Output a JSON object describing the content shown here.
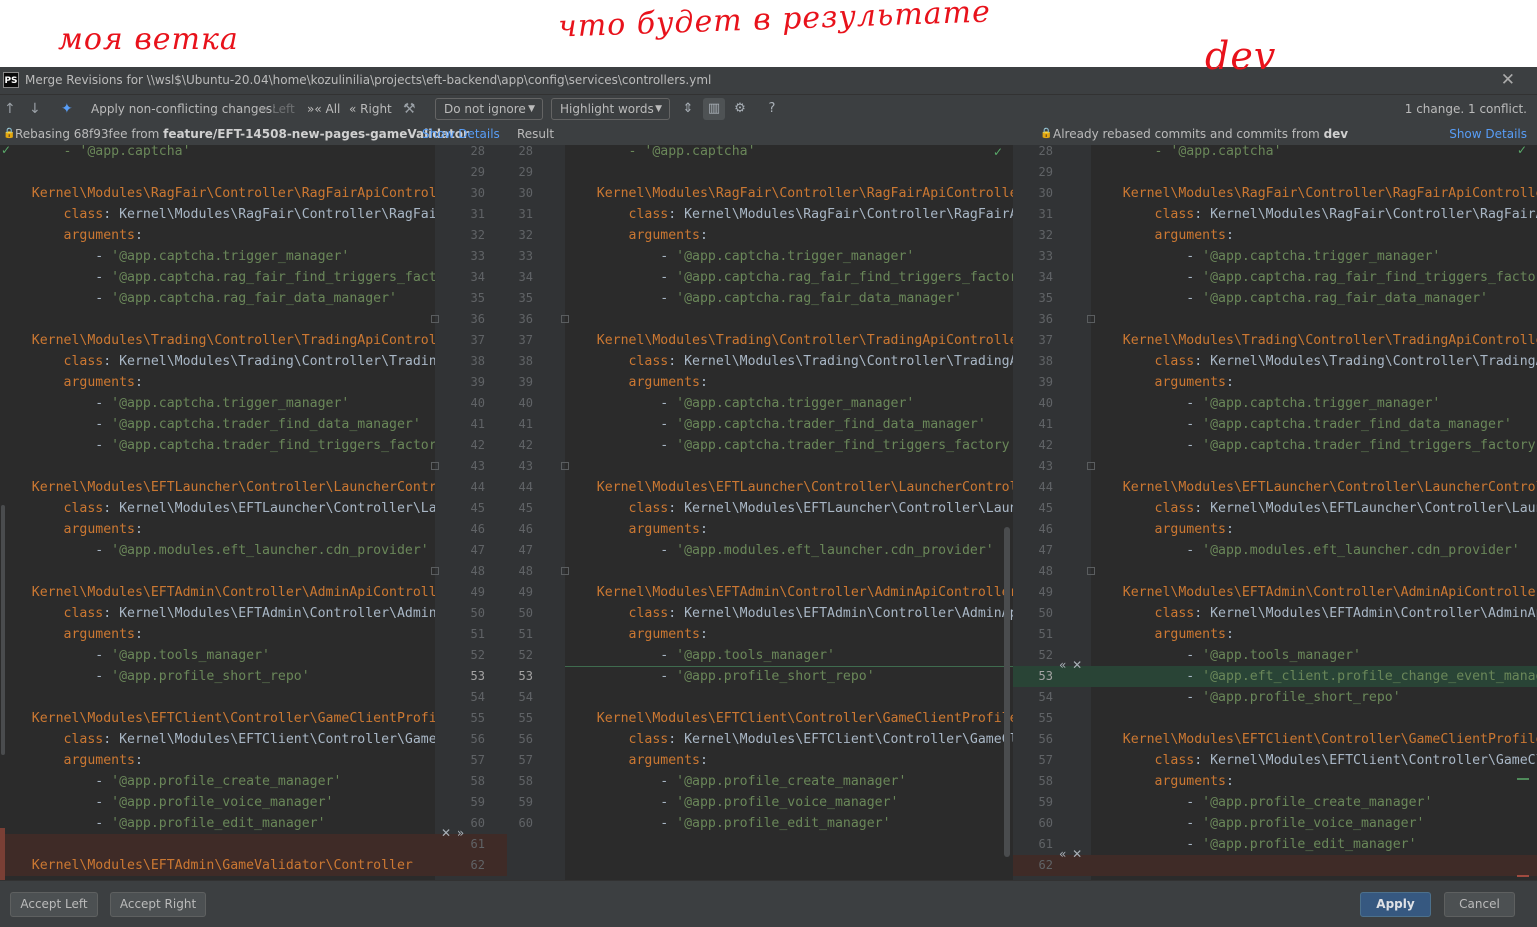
{
  "annotations": {
    "mine": "моя ветка",
    "result": "что будет в результате",
    "dev": "dev"
  },
  "window": {
    "logo": "PS",
    "title": "Merge Revisions for \\\\wsl$\\Ubuntu-20.04\\home\\kozulinilia\\projects\\eft-backend\\app\\config\\services\\controllers.yml"
  },
  "toolbar": {
    "apply_non_conflicting": "Apply non-conflicting changes:",
    "left": "Left",
    "all": "All",
    "right": "Right",
    "whitespace": "Do not ignore",
    "highlight": "Highlight words",
    "status": "1 change. 1 conflict."
  },
  "info": {
    "left_text": "Rebasing 68f93fee from ",
    "left_branch": "feature/EFT-14508-new-pages-gameValidator",
    "show_details": "Show Details",
    "result": "Result",
    "right_text": "Already rebased commits and commits from ",
    "right_branch": "dev"
  },
  "panes": {
    "left": [
      [
        {
          "c": "s",
          "t": "        - '@app.captcha'"
        }
      ],
      [],
      [
        {
          "c": "k",
          "t": "    Kernel\\Modules\\RagFair\\Controller\\RagFairApiController"
        }
      ],
      [
        {
          "c": "k",
          "t": "        class"
        },
        {
          "c": "p",
          "t": ": Kernel\\Modules\\RagFair\\Controller\\RagFairApiController"
        }
      ],
      [
        {
          "c": "k",
          "t": "        arguments"
        },
        {
          "c": "p",
          "t": ":"
        }
      ],
      [
        {
          "c": "p",
          "t": "            - "
        },
        {
          "c": "s",
          "t": "'@app.captcha.trigger_manager'"
        }
      ],
      [
        {
          "c": "p",
          "t": "            - "
        },
        {
          "c": "s",
          "t": "'@app.captcha.rag_fair_find_triggers_factory'"
        }
      ],
      [
        {
          "c": "p",
          "t": "            - "
        },
        {
          "c": "s",
          "t": "'@app.captcha.rag_fair_data_manager'"
        }
      ],
      [],
      [
        {
          "c": "k",
          "t": "    Kernel\\Modules\\Trading\\Controller\\TradingApiController"
        }
      ],
      [
        {
          "c": "k",
          "t": "        class"
        },
        {
          "c": "p",
          "t": ": Kernel\\Modules\\Trading\\Controller\\TradingApiController"
        }
      ],
      [
        {
          "c": "k",
          "t": "        arguments"
        },
        {
          "c": "p",
          "t": ":"
        }
      ],
      [
        {
          "c": "p",
          "t": "            - "
        },
        {
          "c": "s",
          "t": "'@app.captcha.trigger_manager'"
        }
      ],
      [
        {
          "c": "p",
          "t": "            - "
        },
        {
          "c": "s",
          "t": "'@app.captcha.trader_find_data_manager'"
        }
      ],
      [
        {
          "c": "p",
          "t": "            - "
        },
        {
          "c": "s",
          "t": "'@app.captcha.trader_find_triggers_factory'"
        }
      ],
      [],
      [
        {
          "c": "k",
          "t": "    Kernel\\Modules\\EFTLauncher\\Controller\\LauncherController"
        }
      ],
      [
        {
          "c": "k",
          "t": "        class"
        },
        {
          "c": "p",
          "t": ": Kernel\\Modules\\EFTLauncher\\Controller\\LauncherController"
        }
      ],
      [
        {
          "c": "k",
          "t": "        arguments"
        },
        {
          "c": "p",
          "t": ":"
        }
      ],
      [
        {
          "c": "p",
          "t": "            - "
        },
        {
          "c": "s",
          "t": "'@app.modules.eft_launcher.cdn_provider'"
        }
      ],
      [],
      [
        {
          "c": "k",
          "t": "    Kernel\\Modules\\EFTAdmin\\Controller\\AdminApiController"
        }
      ],
      [
        {
          "c": "k",
          "t": "        class"
        },
        {
          "c": "p",
          "t": ": Kernel\\Modules\\EFTAdmin\\Controller\\AdminApiController"
        }
      ],
      [
        {
          "c": "k",
          "t": "        arguments"
        },
        {
          "c": "p",
          "t": ":"
        }
      ],
      [
        {
          "c": "p",
          "t": "            - "
        },
        {
          "c": "s",
          "t": "'@app.tools_manager'"
        }
      ],
      [
        {
          "c": "p",
          "t": "            - "
        },
        {
          "c": "s",
          "t": "'@app.profile_short_repo'"
        }
      ],
      [],
      [
        {
          "c": "k",
          "t": "    Kernel\\Modules\\EFTClient\\Controller\\GameClientProfileController"
        }
      ],
      [
        {
          "c": "k",
          "t": "        class"
        },
        {
          "c": "p",
          "t": ": Kernel\\Modules\\EFTClient\\Controller\\GameClientProfileController"
        }
      ],
      [
        {
          "c": "k",
          "t": "        arguments"
        },
        {
          "c": "p",
          "t": ":"
        }
      ],
      [
        {
          "c": "p",
          "t": "            - "
        },
        {
          "c": "s",
          "t": "'@app.profile_create_manager'"
        }
      ],
      [
        {
          "c": "p",
          "t": "            - "
        },
        {
          "c": "s",
          "t": "'@app.profile_voice_manager'"
        }
      ],
      [
        {
          "c": "p",
          "t": "            - "
        },
        {
          "c": "s",
          "t": "'@app.profile_edit_manager'"
        }
      ],
      [],
      [
        {
          "c": "k",
          "t": "    Kernel\\Modules\\EFTAdmin\\GameValidator\\Controller"
        }
      ]
    ],
    "result": [
      [
        {
          "c": "s",
          "t": "        - '@app.captcha'"
        }
      ],
      [],
      [
        {
          "c": "k",
          "t": "    Kernel\\Modules\\RagFair\\Controller\\RagFairApiController"
        }
      ],
      [
        {
          "c": "k",
          "t": "        class"
        },
        {
          "c": "p",
          "t": ": Kernel\\Modules\\RagFair\\Controller\\RagFairApiController"
        }
      ],
      [
        {
          "c": "k",
          "t": "        arguments"
        },
        {
          "c": "p",
          "t": ":"
        }
      ],
      [
        {
          "c": "p",
          "t": "            - "
        },
        {
          "c": "s",
          "t": "'@app.captcha.trigger_manager'"
        }
      ],
      [
        {
          "c": "p",
          "t": "            - "
        },
        {
          "c": "s",
          "t": "'@app.captcha.rag_fair_find_triggers_factory'"
        }
      ],
      [
        {
          "c": "p",
          "t": "            - "
        },
        {
          "c": "s",
          "t": "'@app.captcha.rag_fair_data_manager'"
        }
      ],
      [],
      [
        {
          "c": "k",
          "t": "    Kernel\\Modules\\Trading\\Controller\\TradingApiController"
        }
      ],
      [
        {
          "c": "k",
          "t": "        class"
        },
        {
          "c": "p",
          "t": ": Kernel\\Modules\\Trading\\Controller\\TradingApiController"
        }
      ],
      [
        {
          "c": "k",
          "t": "        arguments"
        },
        {
          "c": "p",
          "t": ":"
        }
      ],
      [
        {
          "c": "p",
          "t": "            - "
        },
        {
          "c": "s",
          "t": "'@app.captcha.trigger_manager'"
        }
      ],
      [
        {
          "c": "p",
          "t": "            - "
        },
        {
          "c": "s",
          "t": "'@app.captcha.trader_find_data_manager'"
        }
      ],
      [
        {
          "c": "p",
          "t": "            - "
        },
        {
          "c": "s",
          "t": "'@app.captcha.trader_find_triggers_factory'"
        }
      ],
      [],
      [
        {
          "c": "k",
          "t": "    Kernel\\Modules\\EFTLauncher\\Controller\\LauncherController"
        }
      ],
      [
        {
          "c": "k",
          "t": "        class"
        },
        {
          "c": "p",
          "t": ": Kernel\\Modules\\EFTLauncher\\Controller\\LauncherController"
        }
      ],
      [
        {
          "c": "k",
          "t": "        arguments"
        },
        {
          "c": "p",
          "t": ":"
        }
      ],
      [
        {
          "c": "p",
          "t": "            - "
        },
        {
          "c": "s",
          "t": "'@app.modules.eft_launcher.cdn_provider'"
        }
      ],
      [],
      [
        {
          "c": "k",
          "t": "    Kernel\\Modules\\EFTAdmin\\Controller\\AdminApiController"
        }
      ],
      [
        {
          "c": "k",
          "t": "        class"
        },
        {
          "c": "p",
          "t": ": Kernel\\Modules\\EFTAdmin\\Controller\\AdminApiController"
        }
      ],
      [
        {
          "c": "k",
          "t": "        arguments"
        },
        {
          "c": "p",
          "t": ":"
        }
      ],
      [
        {
          "c": "p",
          "t": "            - "
        },
        {
          "c": "s",
          "t": "'@app.tools_manager'"
        }
      ],
      [
        {
          "c": "p",
          "t": "            - "
        },
        {
          "c": "s",
          "t": "'@app.profile_short_repo'"
        }
      ],
      [],
      [
        {
          "c": "k",
          "t": "    Kernel\\Modules\\EFTClient\\Controller\\GameClientProfileController"
        }
      ],
      [
        {
          "c": "k",
          "t": "        class"
        },
        {
          "c": "p",
          "t": ": Kernel\\Modules\\EFTClient\\Controller\\GameClientProfileController"
        }
      ],
      [
        {
          "c": "k",
          "t": "        arguments"
        },
        {
          "c": "p",
          "t": ":"
        }
      ],
      [
        {
          "c": "p",
          "t": "            - "
        },
        {
          "c": "s",
          "t": "'@app.profile_create_manager'"
        }
      ],
      [
        {
          "c": "p",
          "t": "            - "
        },
        {
          "c": "s",
          "t": "'@app.profile_voice_manager'"
        }
      ],
      [
        {
          "c": "p",
          "t": "            - "
        },
        {
          "c": "s",
          "t": "'@app.profile_edit_manager'"
        }
      ]
    ],
    "right": [
      [
        {
          "c": "s",
          "t": "        - '@app.captcha'"
        }
      ],
      [],
      [
        {
          "c": "k",
          "t": "    Kernel\\Modules\\RagFair\\Controller\\RagFairApiController"
        }
      ],
      [
        {
          "c": "k",
          "t": "        class"
        },
        {
          "c": "p",
          "t": ": Kernel\\Modules\\RagFair\\Controller\\RagFairApiController"
        }
      ],
      [
        {
          "c": "k",
          "t": "        arguments"
        },
        {
          "c": "p",
          "t": ":"
        }
      ],
      [
        {
          "c": "p",
          "t": "            - "
        },
        {
          "c": "s",
          "t": "'@app.captcha.trigger_manager'"
        }
      ],
      [
        {
          "c": "p",
          "t": "            - "
        },
        {
          "c": "s",
          "t": "'@app.captcha.rag_fair_find_triggers_factory'"
        }
      ],
      [
        {
          "c": "p",
          "t": "            - "
        },
        {
          "c": "s",
          "t": "'@app.captcha.rag_fair_data_manager'"
        }
      ],
      [],
      [
        {
          "c": "k",
          "t": "    Kernel\\Modules\\Trading\\Controller\\TradingApiController"
        }
      ],
      [
        {
          "c": "k",
          "t": "        class"
        },
        {
          "c": "p",
          "t": ": Kernel\\Modules\\Trading\\Controller\\TradingApiController"
        }
      ],
      [
        {
          "c": "k",
          "t": "        arguments"
        },
        {
          "c": "p",
          "t": ":"
        }
      ],
      [
        {
          "c": "p",
          "t": "            - "
        },
        {
          "c": "s",
          "t": "'@app.captcha.trigger_manager'"
        }
      ],
      [
        {
          "c": "p",
          "t": "            - "
        },
        {
          "c": "s",
          "t": "'@app.captcha.trader_find_data_manager'"
        }
      ],
      [
        {
          "c": "p",
          "t": "            - "
        },
        {
          "c": "s",
          "t": "'@app.captcha.trader_find_triggers_factory'"
        }
      ],
      [],
      [
        {
          "c": "k",
          "t": "    Kernel\\Modules\\EFTLauncher\\Controller\\LauncherController"
        }
      ],
      [
        {
          "c": "k",
          "t": "        class"
        },
        {
          "c": "p",
          "t": ": Kernel\\Modules\\EFTLauncher\\Controller\\LauncherController"
        }
      ],
      [
        {
          "c": "k",
          "t": "        arguments"
        },
        {
          "c": "p",
          "t": ":"
        }
      ],
      [
        {
          "c": "p",
          "t": "            - "
        },
        {
          "c": "s",
          "t": "'@app.modules.eft_launcher.cdn_provider'"
        }
      ],
      [],
      [
        {
          "c": "k",
          "t": "    Kernel\\Modules\\EFTAdmin\\Controller\\AdminApiController"
        }
      ],
      [
        {
          "c": "k",
          "t": "        class"
        },
        {
          "c": "p",
          "t": ": Kernel\\Modules\\EFTAdmin\\Controller\\AdminApiController"
        }
      ],
      [
        {
          "c": "k",
          "t": "        arguments"
        },
        {
          "c": "p",
          "t": ":"
        }
      ],
      [
        {
          "c": "p",
          "t": "            - "
        },
        {
          "c": "s",
          "t": "'@app.tools_manager'"
        }
      ],
      [
        {
          "c": "p",
          "t": "            - "
        },
        {
          "c": "s",
          "t": "'@app.eft_client.profile_change_event_manager'"
        }
      ],
      [
        {
          "c": "p",
          "t": "            - "
        },
        {
          "c": "s",
          "t": "'@app.profile_short_repo'"
        }
      ],
      [],
      [
        {
          "c": "k",
          "t": "    Kernel\\Modules\\EFTClient\\Controller\\GameClientProfileController"
        }
      ],
      [
        {
          "c": "k",
          "t": "        class"
        },
        {
          "c": "p",
          "t": ": Kernel\\Modules\\EFTClient\\Controller\\GameClientProfileController"
        }
      ],
      [
        {
          "c": "k",
          "t": "        arguments"
        },
        {
          "c": "p",
          "t": ":"
        }
      ],
      [
        {
          "c": "p",
          "t": "            - "
        },
        {
          "c": "s",
          "t": "'@app.profile_create_manager'"
        }
      ],
      [
        {
          "c": "p",
          "t": "            - "
        },
        {
          "c": "s",
          "t": "'@app.profile_voice_manager'"
        }
      ],
      [
        {
          "c": "p",
          "t": "            - "
        },
        {
          "c": "s",
          "t": "'@app.profile_edit_manager'"
        }
      ],
      []
    ]
  },
  "gutters": {
    "left_numbers": [
      28,
      29,
      30,
      31,
      32,
      33,
      34,
      35,
      36,
      37,
      38,
      39,
      40,
      41,
      42,
      43,
      44,
      45,
      46,
      47,
      48,
      49,
      50,
      51,
      52,
      53,
      54,
      55,
      56,
      57,
      58,
      59,
      60,
      61,
      62
    ],
    "result_numbers": [
      28,
      29,
      30,
      31,
      32,
      33,
      34,
      35,
      36,
      37,
      38,
      39,
      40,
      41,
      42,
      43,
      44,
      45,
      46,
      47,
      48,
      49,
      50,
      51,
      52,
      53,
      54,
      55,
      56,
      57,
      58,
      59,
      60
    ],
    "right_numbers": [
      28,
      29,
      30,
      31,
      32,
      33,
      34,
      35,
      36,
      37,
      38,
      39,
      40,
      41,
      42,
      43,
      44,
      45,
      46,
      47,
      48,
      49,
      50,
      51,
      52,
      53,
      54,
      55,
      56,
      57,
      58,
      59,
      60,
      61,
      62
    ],
    "current_line": 53
  },
  "buttons": {
    "accept_left": "Accept Left",
    "accept_right": "Accept Right",
    "apply": "Apply",
    "cancel": "Cancel"
  },
  "colors": {
    "editor_bg": "#2b2b2b",
    "panel_bg": "#3c3f41",
    "keyword": "#cc7832",
    "string": "#6a8759",
    "conflict": "#3f2b27",
    "insertion": "#294436",
    "accent": "#365880",
    "annotation": "#e8121b"
  }
}
